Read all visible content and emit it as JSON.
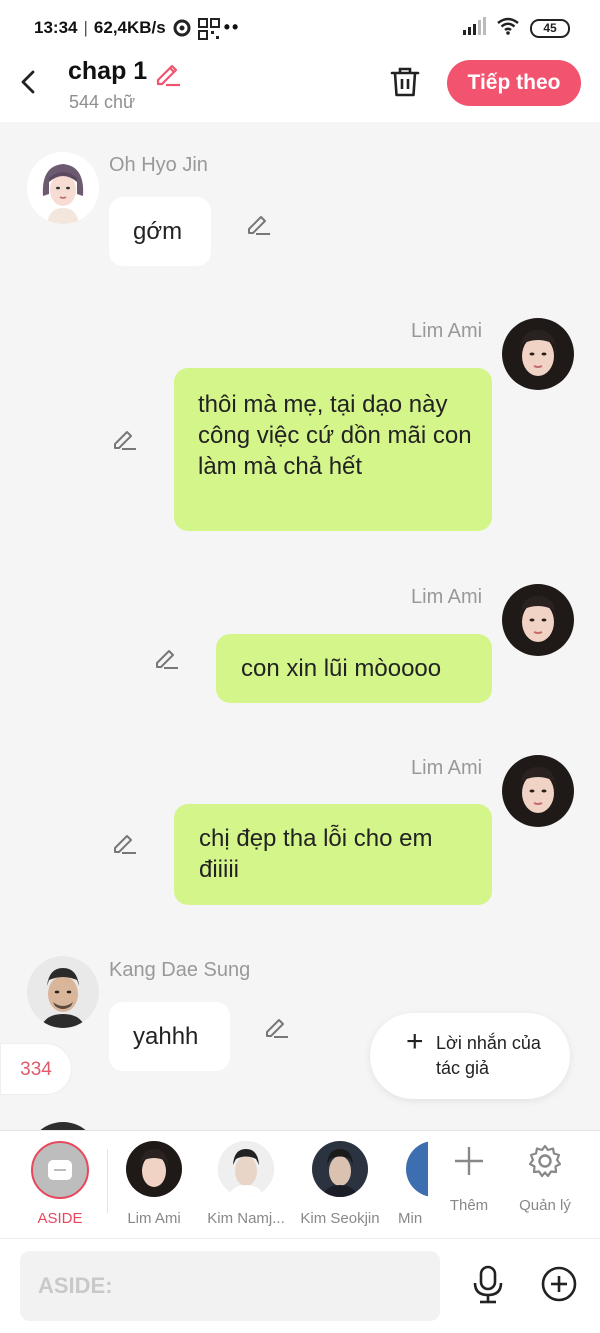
{
  "status_bar": {
    "time": "13:34",
    "network_speed": "62,4KB/s",
    "battery": "45"
  },
  "header": {
    "chapter_title": "chap 1",
    "word_count": "544 chữ",
    "next_label": "Tiếp theo"
  },
  "messages": [
    {
      "sender": "Oh Hyo Jin",
      "text": "gớm",
      "side": "left"
    },
    {
      "sender": "Lim Ami",
      "text": "thôi mà mẹ, tại dạo này công việc cứ dồn mãi con làm mà chả hết",
      "side": "right"
    },
    {
      "sender": "Lim Ami",
      "text": "con xin lũi mòoooo",
      "side": "right"
    },
    {
      "sender": "Lim Ami",
      "text": "chị đẹp tha lỗi cho em điiiii",
      "side": "right"
    },
    {
      "sender": "Kang Dae Sung",
      "text": "yahhh",
      "side": "left"
    }
  ],
  "floating": {
    "count_badge": "334",
    "author_note_label": "Lời nhắn của tác giả"
  },
  "characters": [
    {
      "name": "ASIDE"
    },
    {
      "name": "Lim Ami"
    },
    {
      "name": "Kim Namj..."
    },
    {
      "name": "Kim Seokjin"
    },
    {
      "name": "Min"
    }
  ],
  "charbar_actions": {
    "add_label": "Thêm",
    "manage_label": "Quản lý"
  },
  "input": {
    "placeholder": "ASIDE:"
  },
  "colors": {
    "accent": "#f2536f",
    "bubble_right": "#d4f58a",
    "bubble_left": "#ffffff",
    "background": "#f5f5f5"
  }
}
